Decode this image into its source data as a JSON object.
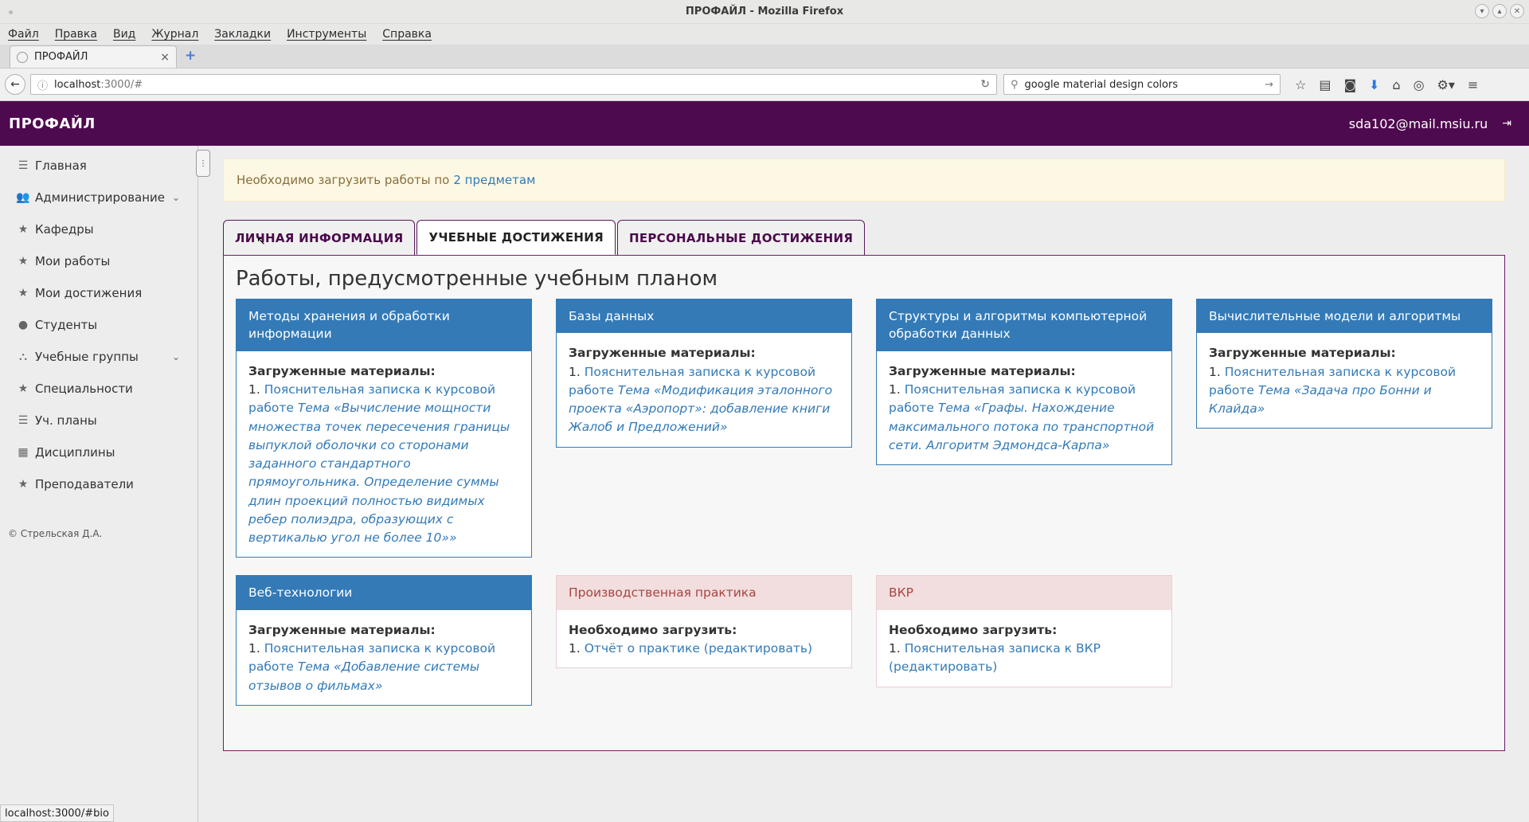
{
  "window": {
    "title": "ПРОФАЙЛ - Mozilla Firefox"
  },
  "menu": [
    "Файл",
    "Правка",
    "Вид",
    "Журнал",
    "Закладки",
    "Инструменты",
    "Справка"
  ],
  "browser_tab": {
    "title": "ПРОФАЙЛ",
    "close": "×",
    "new_tab": "+"
  },
  "nav": {
    "url_host": "localhost",
    "url_path": ":3000/#",
    "search_value": "google material design colors"
  },
  "app": {
    "brand": "ПРОФАЙЛ",
    "user_email": "sda102@mail.msiu.ru"
  },
  "sidebar": {
    "items": [
      {
        "label": "Главная",
        "icon": "list-icon"
      },
      {
        "label": "Администрирование",
        "icon": "users-icon",
        "chevron": true
      },
      {
        "label": "Кафедры",
        "icon": "star-icon"
      },
      {
        "label": "Мои работы",
        "icon": "star-icon"
      },
      {
        "label": "Мои достижения",
        "icon": "star-icon"
      },
      {
        "label": "Студенты",
        "icon": "user-icon"
      },
      {
        "label": "Учебные группы",
        "icon": "sitemap-icon",
        "chevron": true
      },
      {
        "label": "Специальности",
        "icon": "star-icon"
      },
      {
        "label": "Уч. планы",
        "icon": "list-icon"
      },
      {
        "label": "Дисциплины",
        "icon": "grid-icon"
      },
      {
        "label": "Преподаватели",
        "icon": "star-icon"
      }
    ],
    "copyright": "© Стрельская Д.А."
  },
  "alert": {
    "text": "Необходимо загрузить работы по",
    "link": "2 предметам"
  },
  "tabs": [
    {
      "label": "Личная информация",
      "active": false
    },
    {
      "label": "Учебные достижения",
      "active": true
    },
    {
      "label": "Персональные достижения",
      "active": false
    }
  ],
  "section_title": "Работы, предусмотренные учебным планом",
  "cards": {
    "c1": {
      "title": "Методы хранения и обработки информации",
      "label": "Загруженные материалы:",
      "num": "1.",
      "link": "Пояснительная записка к курсовой работе",
      "topic": "Тема «Вычисление мощности множества точек пересечения границы выпуклой оболочки со сторонами заданного стандартного прямоугольника. Определение суммы длин проекций полностью видимых ребер полиэдра, образующих с вертикалью угол не более 10»»"
    },
    "c2": {
      "title": "Базы данных",
      "label": "Загруженные материалы:",
      "num": "1.",
      "link": "Пояснительная записка к курсовой работе",
      "topic": "Тема «Модификация эталонного проекта «Аэропорт»: добавление книги Жалоб и Предложений»"
    },
    "c3": {
      "title": "Структуры и алгоритмы компьютерной обработки данных",
      "label": "Загруженные материалы:",
      "num": "1.",
      "link": "Пояснительная записка к курсовой работе",
      "topic": "Тема «Графы. Нахождение максимального потока по транспортной сети. Алгоритм Эдмондса-Карпа»"
    },
    "c4": {
      "title": "Вычислительные модели и алгоритмы",
      "label": "Загруженные материалы:",
      "num": "1.",
      "link": "Пояснительная записка к курсовой работе",
      "topic": "Тема «Задача про Бонни и Клайда»"
    },
    "c5": {
      "title": "Веб-технологии",
      "label": "Загруженные материалы:",
      "num": "1.",
      "link": "Пояснительная записка к курсовой работе",
      "topic": "Тема «Добавление системы отзывов о фильмах»"
    },
    "c6": {
      "title": "Производственная практика",
      "label": "Необходимо загрузить:",
      "num": "1.",
      "link": "Отчёт о практике (редактировать)"
    },
    "c7": {
      "title": "ВКР",
      "label": "Необходимо загрузить:",
      "num": "1.",
      "link": "Пояснительная записка к ВКР (редактировать)"
    }
  },
  "statusbar": "localhost:3000/#bio",
  "colors": {
    "brand": "#4e0a4f",
    "primary": "#337ab7",
    "danger_bg": "#f2dede",
    "danger_text": "#a94442",
    "warning_bg": "#fcf8e3"
  }
}
